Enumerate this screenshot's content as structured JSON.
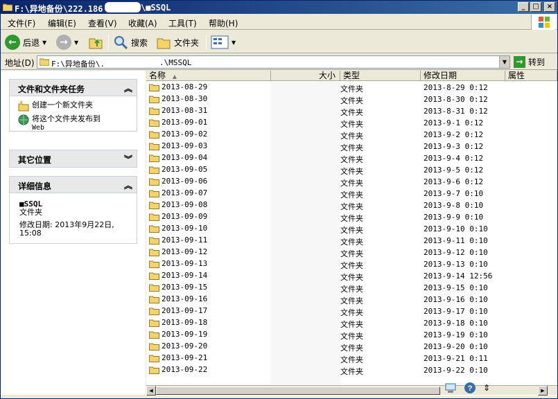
{
  "window": {
    "title": "F:\\异地备份\\222.186",
    "title_suffix": "\\■SSQL",
    "controls": [
      "_",
      "□",
      "×"
    ]
  },
  "menu": [
    "文件(F)",
    "编辑(E)",
    "查看(V)",
    "收藏(A)",
    "工具(T)",
    "帮助(H)"
  ],
  "toolbar": {
    "back": "后退",
    "search": "搜索",
    "folders": "文件夹"
  },
  "address": {
    "label": "地址(D)",
    "path_start": "F:\\异地备份\\.",
    "path_end": ".\\MSSQL",
    "go": "转到"
  },
  "tasks_panel": {
    "title": "文件和文件夹任务",
    "items": [
      {
        "label": "创建一个新文件夹",
        "label2": ""
      },
      {
        "label": "将这个文件夹发布到",
        "label2": "Web"
      }
    ]
  },
  "other_places": {
    "title": "其它位置"
  },
  "details": {
    "title": "详细信息",
    "name": "■SSQL",
    "type": "文件夹",
    "modified_label": "修改日期: 2013年9月22日,",
    "modified_time": "15:08"
  },
  "columns": {
    "name": "名称",
    "size": "大小",
    "type": "类型",
    "modified": "修改日期",
    "attr": "属性"
  },
  "files": [
    {
      "name": "2013-08-29",
      "type": "文件夹",
      "modified": "2013-8-29 0:12"
    },
    {
      "name": "2013-08-30",
      "type": "文件夹",
      "modified": "2013-8-30 0:12"
    },
    {
      "name": "2013-08-31",
      "type": "文件夹",
      "modified": "2013-8-31 0:12"
    },
    {
      "name": "2013-09-01",
      "type": "文件夹",
      "modified": "2013-9-1 0:12"
    },
    {
      "name": "2013-09-02",
      "type": "文件夹",
      "modified": "2013-9-2 0:12"
    },
    {
      "name": "2013-09-03",
      "type": "文件夹",
      "modified": "2013-9-3 0:12"
    },
    {
      "name": "2013-09-04",
      "type": "文件夹",
      "modified": "2013-9-4 0:12"
    },
    {
      "name": "2013-09-05",
      "type": "文件夹",
      "modified": "2013-9-5 0:12"
    },
    {
      "name": "2013-09-06",
      "type": "文件夹",
      "modified": "2013-9-6 0:12"
    },
    {
      "name": "2013-09-07",
      "type": "文件夹",
      "modified": "2013-9-7 0:10"
    },
    {
      "name": "2013-09-08",
      "type": "文件夹",
      "modified": "2013-9-8 0:10"
    },
    {
      "name": "2013-09-09",
      "type": "文件夹",
      "modified": "2013-9-9 0:10"
    },
    {
      "name": "2013-09-10",
      "type": "文件夹",
      "modified": "2013-9-10 0:10"
    },
    {
      "name": "2013-09-11",
      "type": "文件夹",
      "modified": "2013-9-11 0:10"
    },
    {
      "name": "2013-09-12",
      "type": "文件夹",
      "modified": "2013-9-12 0:10"
    },
    {
      "name": "2013-09-13",
      "type": "文件夹",
      "modified": "2013-9-13 0:10"
    },
    {
      "name": "2013-09-14",
      "type": "文件夹",
      "modified": "2013-9-14 12:56"
    },
    {
      "name": "2013-09-15",
      "type": "文件夹",
      "modified": "2013-9-15 0:10"
    },
    {
      "name": "2013-09-16",
      "type": "文件夹",
      "modified": "2013-9-16 0:10"
    },
    {
      "name": "2013-09-17",
      "type": "文件夹",
      "modified": "2013-9-17 0:10"
    },
    {
      "name": "2013-09-18",
      "type": "文件夹",
      "modified": "2013-9-18 0:10"
    },
    {
      "name": "2013-09-19",
      "type": "文件夹",
      "modified": "2013-9-19 0:10"
    },
    {
      "name": "2013-09-20",
      "type": "文件夹",
      "modified": "2013-9-20 0:10"
    },
    {
      "name": "2013-09-21",
      "type": "文件夹",
      "modified": "2013-9-21 0:11"
    },
    {
      "name": "2013-09-22",
      "type": "文件夹",
      "modified": "2013-9-22 0:10"
    }
  ],
  "colors": {
    "folder": "#f4d46a",
    "title_start": "#0a246a",
    "title_end": "#3a6ea5",
    "go": "#2e9a2e"
  }
}
